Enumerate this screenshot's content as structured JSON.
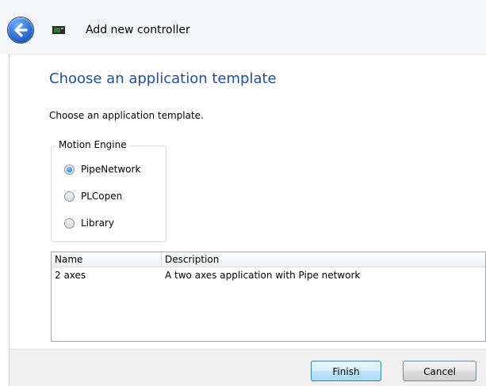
{
  "window": {
    "title": "Add new controller"
  },
  "page": {
    "heading": "Choose an application template",
    "instruction": "Choose an application template."
  },
  "motion_engine": {
    "group_label": "Motion Engine",
    "options": [
      {
        "label": "PipeNetwork",
        "selected": true
      },
      {
        "label": "PLCopen",
        "selected": false
      },
      {
        "label": "Library",
        "selected": false
      }
    ]
  },
  "template_list": {
    "columns": [
      "Name",
      "Description"
    ],
    "rows": [
      {
        "name": "2 axes",
        "description": "A two axes application with Pipe network"
      }
    ]
  },
  "buttons": {
    "finish": "Finish",
    "cancel": "Cancel"
  },
  "icons": {
    "back": "back-arrow-icon",
    "app": "controller-icon"
  },
  "colors": {
    "heading": "#1e4fa3",
    "accent": "#2f6ed3"
  }
}
